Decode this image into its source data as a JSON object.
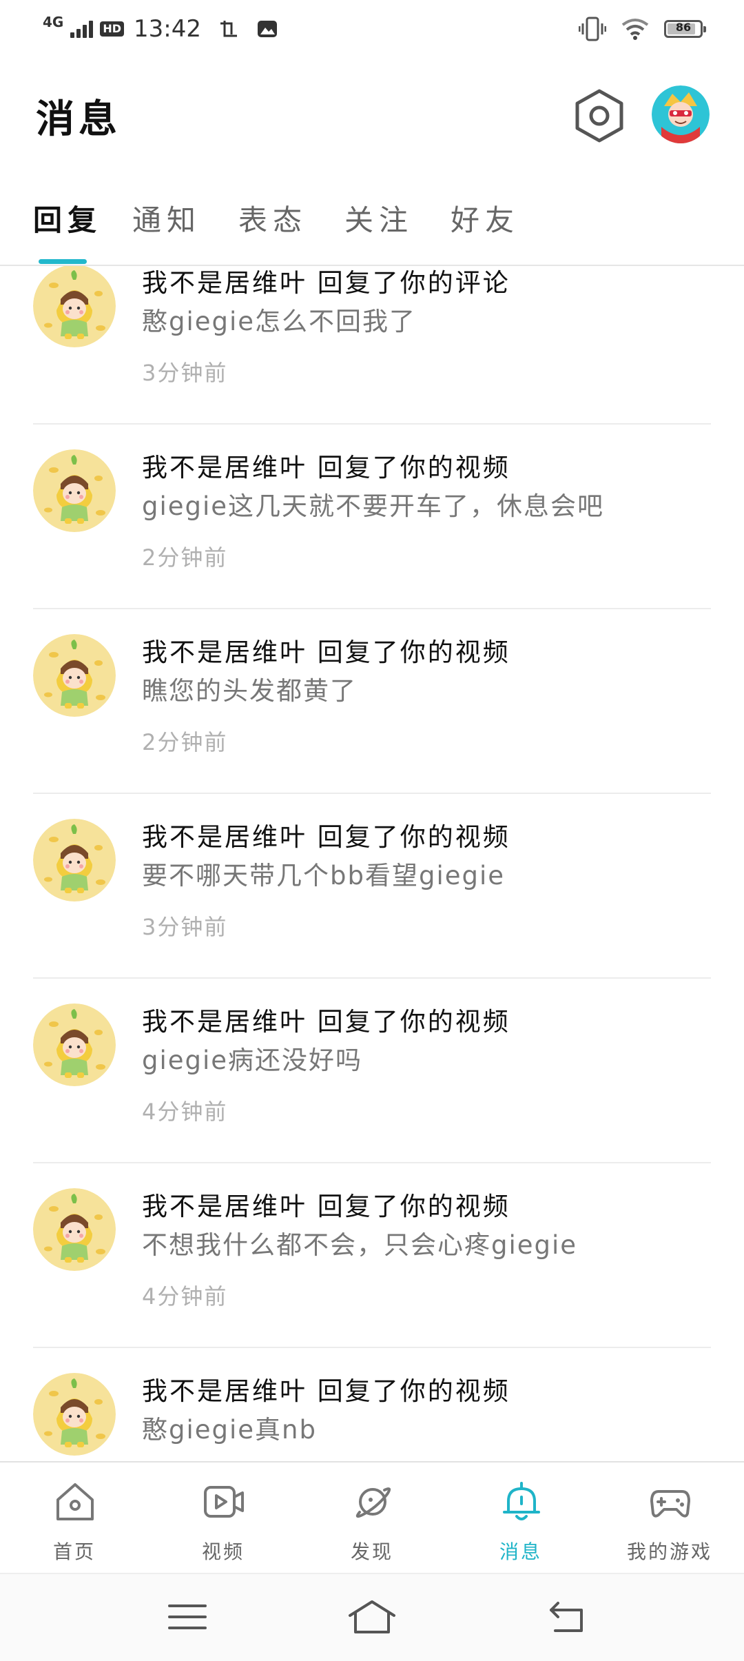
{
  "status_bar": {
    "network": "4G",
    "hd": "HD",
    "time": "13:42",
    "battery": "86",
    "battery_level": 0.86,
    "icons": [
      "signal-icon",
      "screenshot-icon",
      "gallery-icon",
      "vibrate-icon",
      "wifi-icon",
      "battery-icon"
    ]
  },
  "header": {
    "title": "消息",
    "settings_icon": "settings-icon",
    "avatar_icon": "profile-avatar"
  },
  "tabs": [
    {
      "label": "回复",
      "active": true
    },
    {
      "label": "通知",
      "active": false
    },
    {
      "label": "表态",
      "active": false
    },
    {
      "label": "关注",
      "active": false
    },
    {
      "label": "好友",
      "active": false
    }
  ],
  "messages": [
    {
      "title": "我不是居维叶 回复了你的评论",
      "body": "憨giegie怎么不回我了",
      "time": "3分钟前"
    },
    {
      "title": "我不是居维叶 回复了你的视频",
      "body": "giegie这几天就不要开车了，休息会吧",
      "time": "2分钟前"
    },
    {
      "title": "我不是居维叶 回复了你的视频",
      "body": "瞧您的头发都黄了",
      "time": "2分钟前"
    },
    {
      "title": "我不是居维叶 回复了你的视频",
      "body": "要不哪天带几个bb看望giegie",
      "time": "3分钟前"
    },
    {
      "title": "我不是居维叶 回复了你的视频",
      "body": "giegie病还没好吗",
      "time": "4分钟前"
    },
    {
      "title": "我不是居维叶 回复了你的视频",
      "body": "不想我什么都不会，只会心疼giegie",
      "time": "4分钟前"
    },
    {
      "title": "我不是居维叶 回复了你的视频",
      "body": "憨giegie真nb",
      "time": ""
    }
  ],
  "bottom_nav": [
    {
      "label": "首页",
      "icon": "home-icon",
      "active": false
    },
    {
      "label": "视频",
      "icon": "video-icon",
      "active": false
    },
    {
      "label": "发现",
      "icon": "planet-icon",
      "active": false
    },
    {
      "label": "消息",
      "icon": "bell-icon",
      "active": true
    },
    {
      "label": "我的游戏",
      "icon": "gamepad-icon",
      "active": false
    }
  ],
  "system_nav": {
    "icons": [
      "menu-icon",
      "home-outline-icon",
      "back-icon"
    ]
  },
  "colors": {
    "accent": "#22b8cc",
    "avatar_bg": "#f6e29a"
  }
}
